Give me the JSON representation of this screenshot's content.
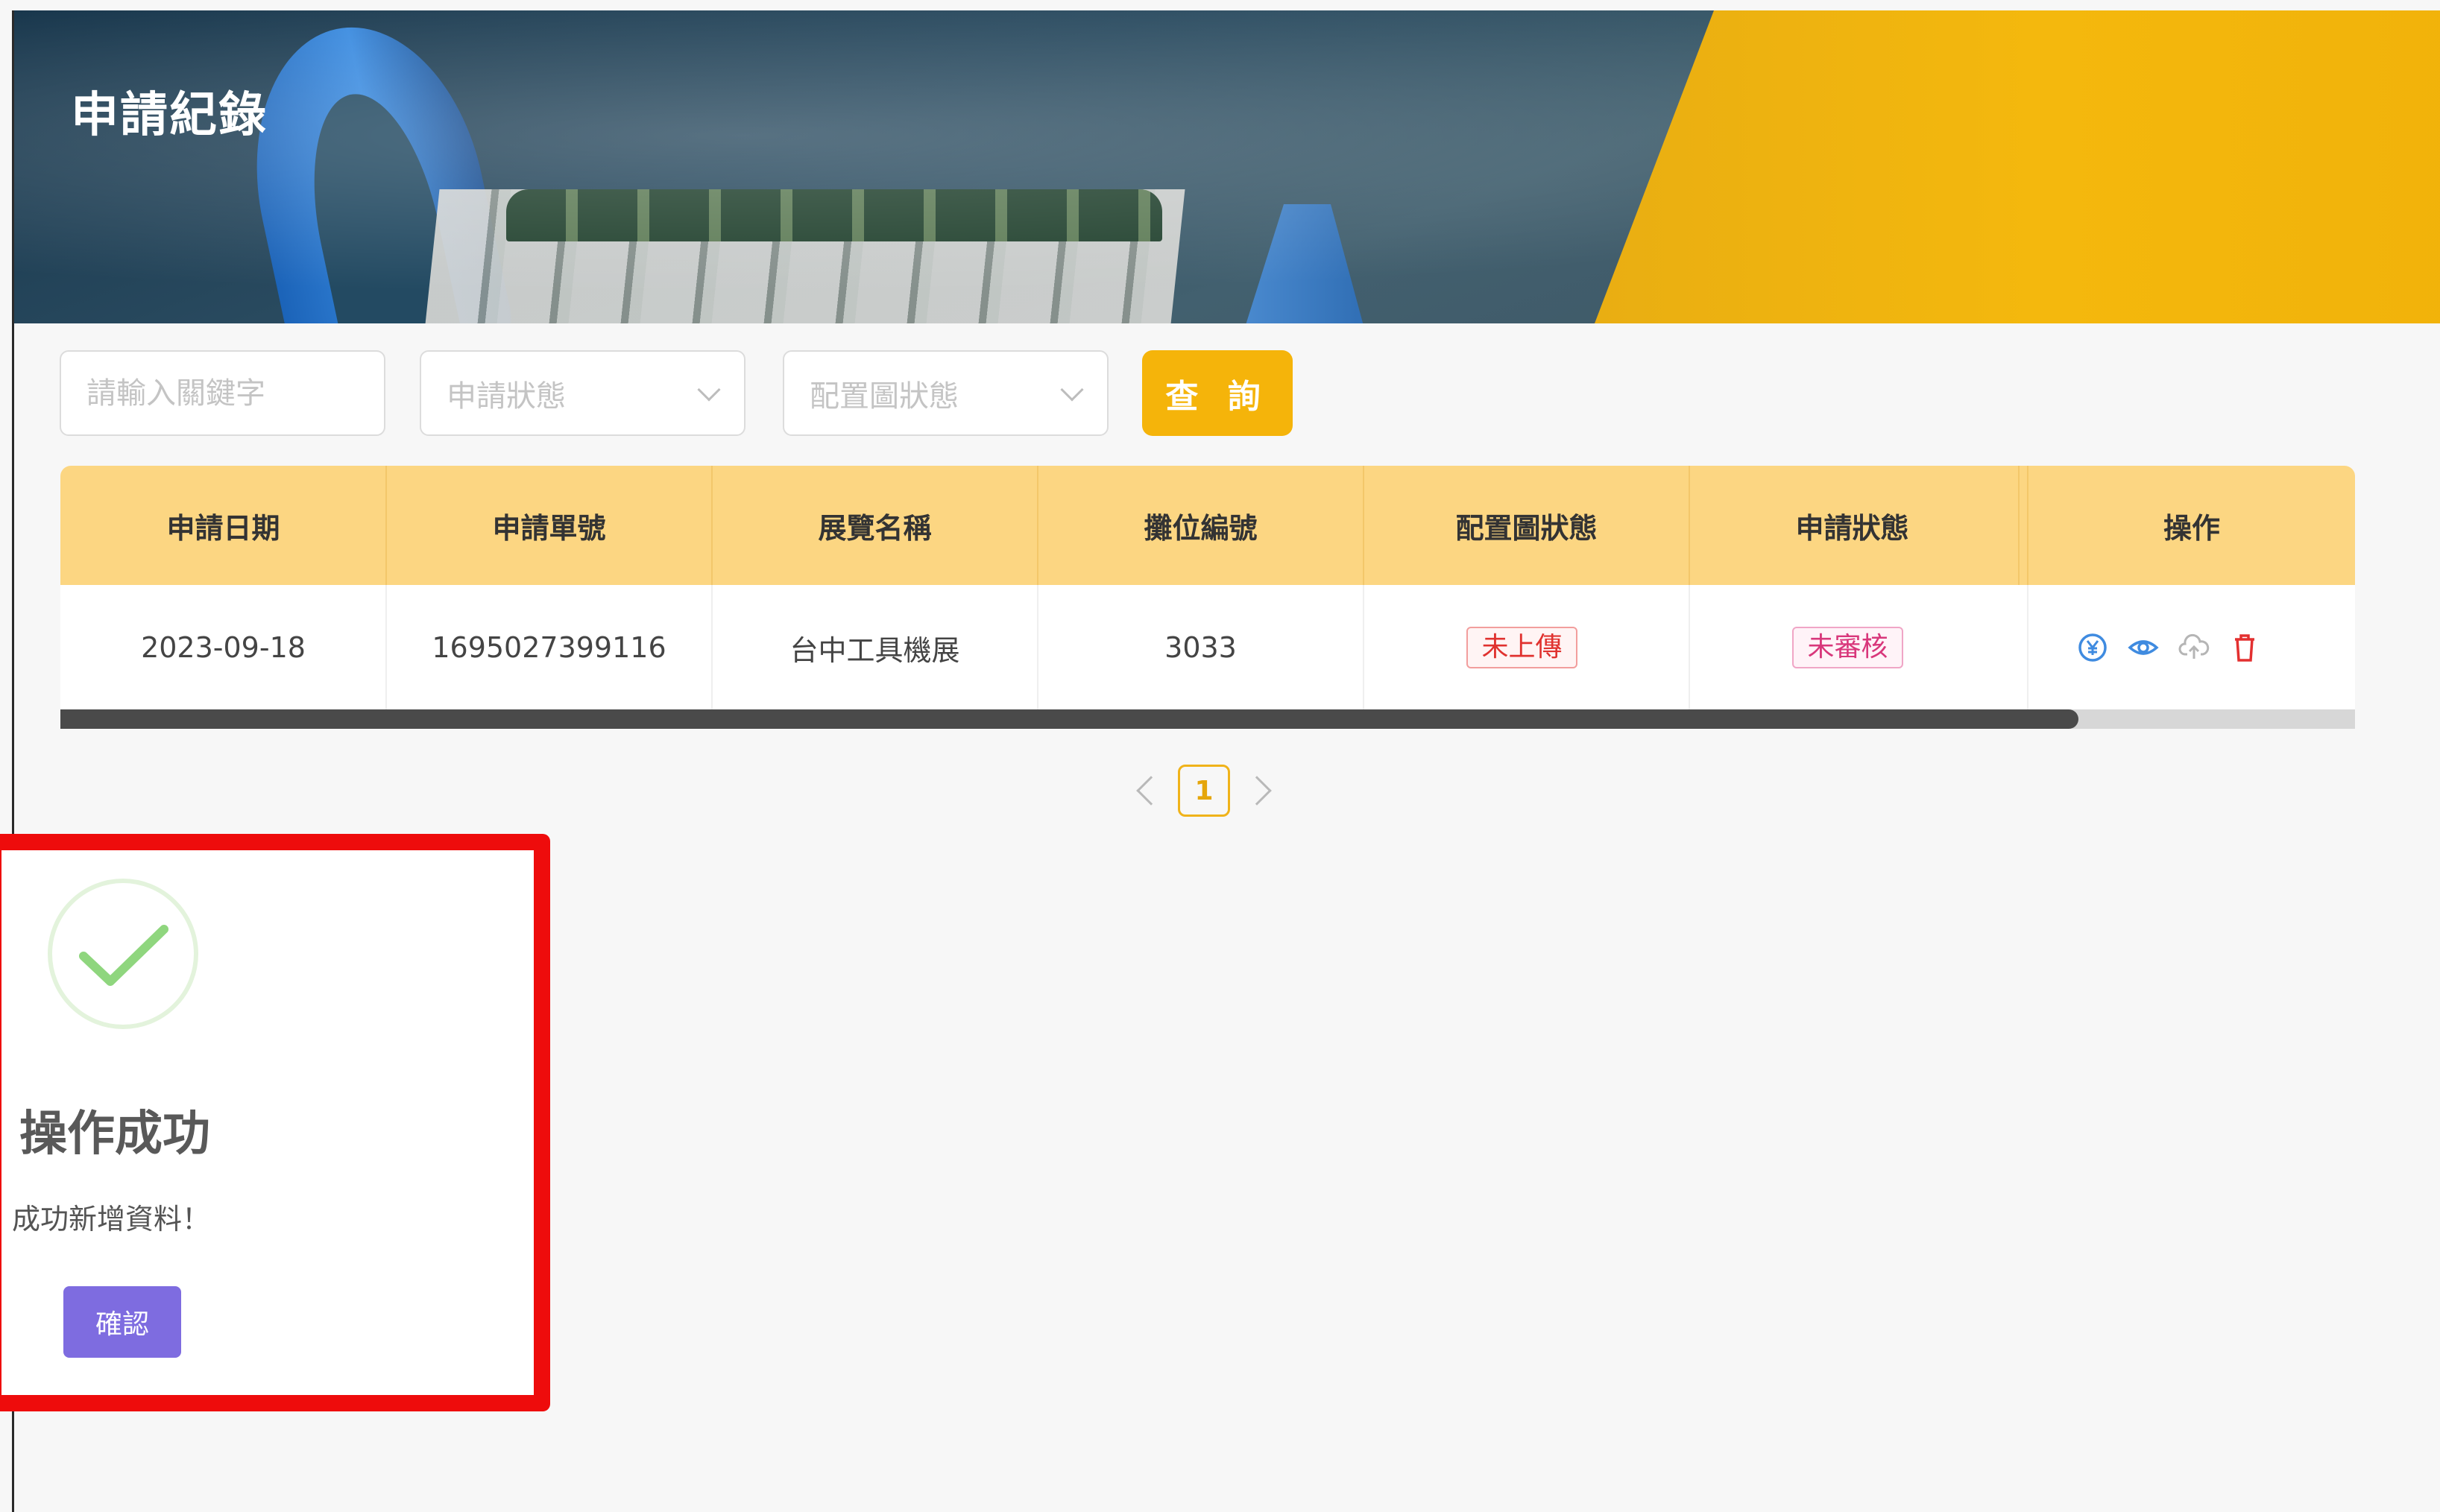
{
  "header": {
    "title": "申請紀錄"
  },
  "filters": {
    "keyword_placeholder": "請輸入關鍵字",
    "apply_status_placeholder": "申請狀態",
    "layout_status_placeholder": "配置圖狀態",
    "search_label": "查 詢"
  },
  "table": {
    "columns": [
      "申請日期",
      "申請單號",
      "展覽名稱",
      "攤位編號",
      "配置圖狀態",
      "申請狀態",
      "操作"
    ],
    "rows": [
      {
        "date": "2023-09-18",
        "order_no": "1695027399116",
        "exhibition": "台中工具機展",
        "booth": "3033",
        "layout_status": "未上傳",
        "apply_status": "未審核",
        "actions": [
          "payment-icon",
          "eye-icon",
          "cloud-upload-icon",
          "trash-icon"
        ]
      }
    ]
  },
  "pagination": {
    "current": "1"
  },
  "dialog": {
    "title": "操作成功",
    "message": "成功新增資料！",
    "confirm_label": "確認"
  },
  "colors": {
    "accent": "#f5b40a",
    "table_header": "#fcd682",
    "success": "#8fd67e",
    "confirm_button": "#7e6ce0",
    "highlight_frame": "#ee0c0c"
  }
}
